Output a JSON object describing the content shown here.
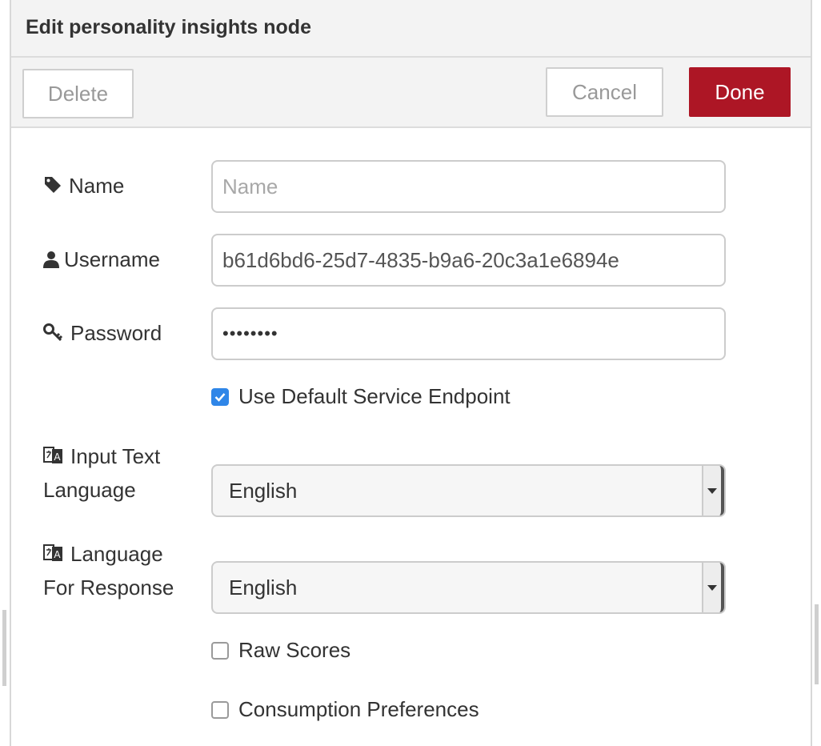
{
  "header": {
    "title": "Edit personality insights node"
  },
  "toolbar": {
    "delete_label": "Delete",
    "cancel_label": "Cancel",
    "done_label": "Done"
  },
  "form": {
    "name": {
      "label": "Name",
      "icon": "tag-icon",
      "value": "",
      "placeholder": "Name"
    },
    "username": {
      "label": "Username",
      "icon": "user-icon",
      "value": "b61d6bd6-25d7-4835-b9a6-20c3a1e6894e"
    },
    "password": {
      "label": "Password",
      "icon": "key-icon",
      "value": "••••••••"
    },
    "default_endpoint": {
      "label": "Use Default Service Endpoint",
      "checked": true
    },
    "input_language": {
      "label_line1": "Input Text",
      "label_line2": "Language",
      "icon": "language-icon",
      "value": "English"
    },
    "response_language": {
      "label_line1": "Language",
      "label_line2": "For Response",
      "icon": "language-icon",
      "value": "English"
    },
    "raw_scores": {
      "label": "Raw Scores",
      "checked": false
    },
    "consumption_preferences": {
      "label": "Consumption Preferences",
      "checked": false
    }
  },
  "colors": {
    "accent": "#ad1625",
    "checkbox": "#2f86e8",
    "header_bg": "#f3f3f3"
  }
}
